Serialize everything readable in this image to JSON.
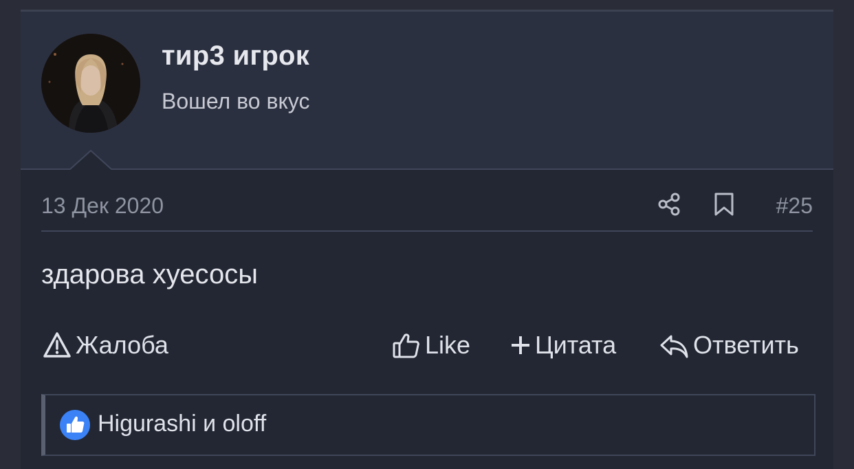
{
  "post": {
    "author": {
      "name": "тир3 игрок",
      "title": "Вошел во вкус"
    },
    "date": "13 Дек 2020",
    "number": "#25",
    "message": "здарова хуесосы",
    "actions": {
      "report": "Жалоба",
      "like": "Like",
      "quote": "Цитата",
      "reply": "Ответить"
    },
    "likes": {
      "text": "Higurashi и oloff"
    }
  },
  "icons": {
    "share": "share-icon",
    "bookmark": "bookmark-icon",
    "report": "warning-triangle-icon",
    "like": "thumbs-up-icon",
    "quote": "plus-icon",
    "reply": "reply-arrow-icon",
    "likes_badge": "like-badge-icon"
  },
  "colors": {
    "background": "#2a2d38",
    "header": "#2b3040",
    "body": "#232733",
    "like_badge": "#3b82f6"
  }
}
